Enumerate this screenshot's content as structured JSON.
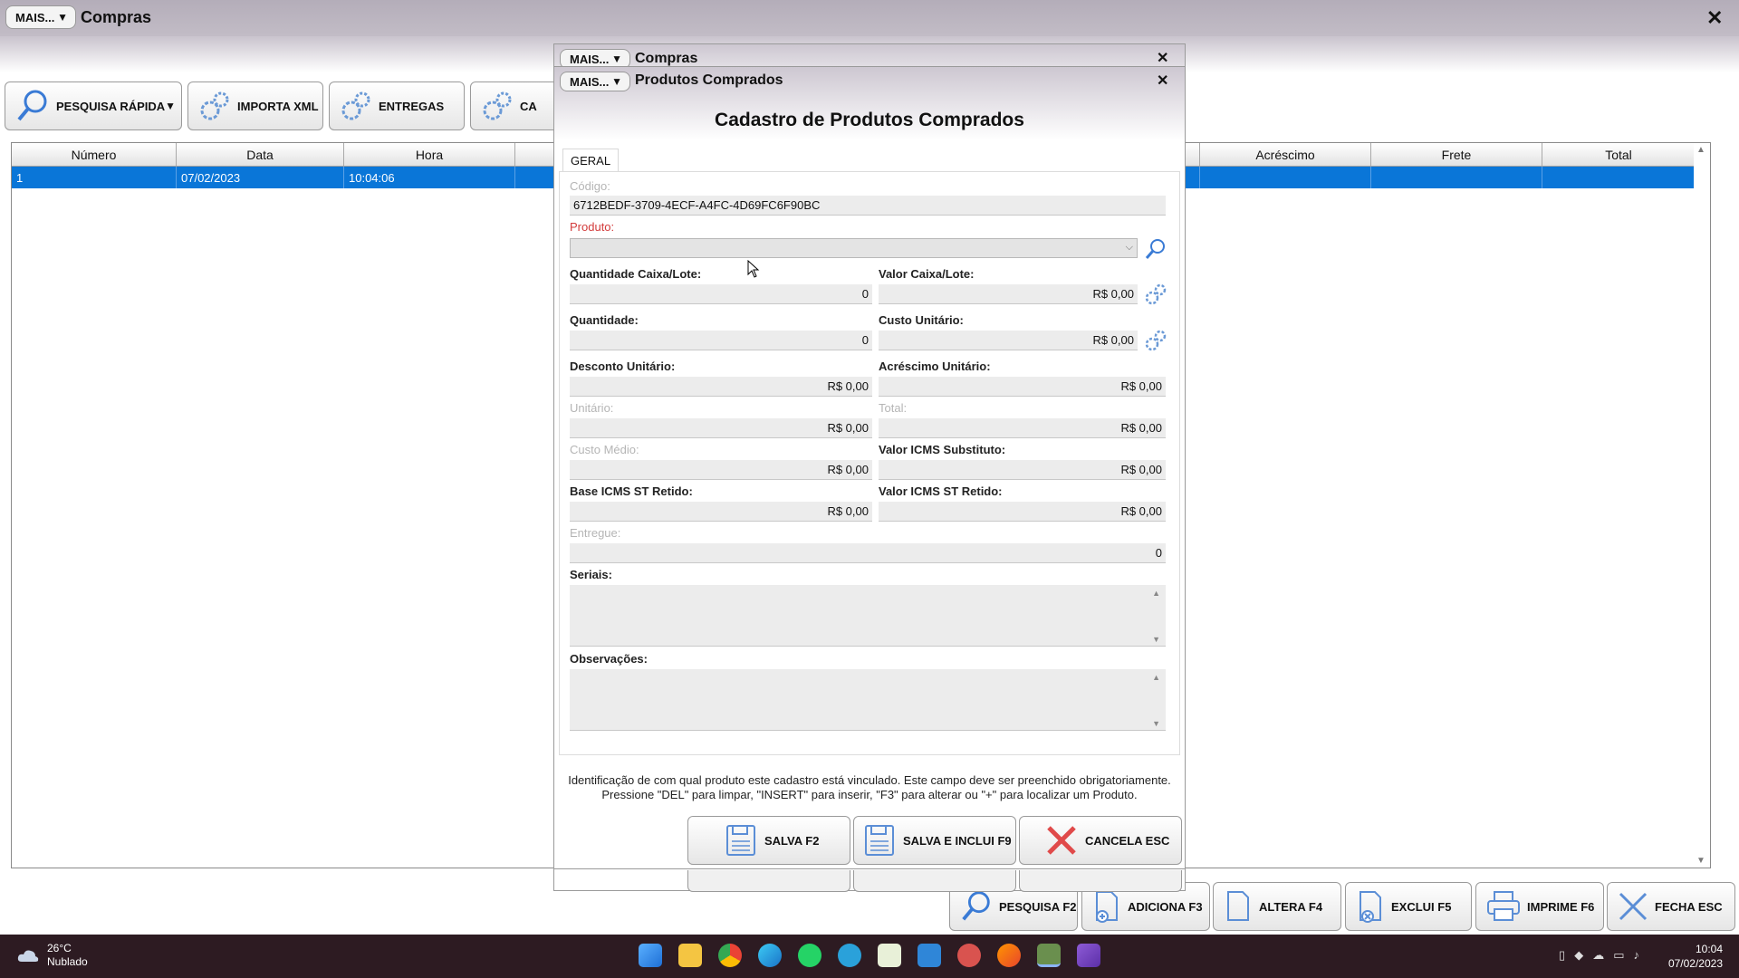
{
  "main": {
    "mais_label": "MAIS...",
    "title": "Compras",
    "toolbar": {
      "pesquisa_rapida": "PESQUISA RÁPIDA",
      "importa_xml": "IMPORTA XML",
      "entregas": "ENTREGAS",
      "partial": "CA"
    },
    "grid": {
      "columns": [
        "Número",
        "Data",
        "Hora",
        "",
        "",
        "",
        "",
        "Acréscimo",
        "Frete",
        "Total"
      ],
      "rows": [
        {
          "numero": "1",
          "data": "07/02/2023",
          "hora": "10:04:06"
        }
      ]
    },
    "bottom": {
      "pesquisa": "PESQUISA F2",
      "adiciona": "ADICIONA F3",
      "altera": "ALTERA F4",
      "exclui": "EXCLUI F5",
      "imprime": "IMPRIME F6",
      "fecha": "FECHA ESC"
    }
  },
  "outer_dialog": {
    "mais_label": "MAIS...",
    "title": "Compras"
  },
  "dialog": {
    "mais_label": "MAIS...",
    "window_title": "Produtos Comprados",
    "heading": "Cadastro de Produtos Comprados",
    "tab": "GERAL",
    "fields": {
      "codigo_label": "Código:",
      "codigo_value": "6712BEDF-3709-4ECF-A4FC-4D69FC6F90BC",
      "produto_label": "Produto:",
      "produto_value": "",
      "qtd_caixa_label": "Quantidade Caixa/Lote:",
      "qtd_caixa_value": "0",
      "valor_caixa_label": "Valor Caixa/Lote:",
      "valor_caixa_value": "R$ 0,00",
      "quantidade_label": "Quantidade:",
      "quantidade_value": "0",
      "custo_unit_label": "Custo Unitário:",
      "custo_unit_value": "R$ 0,00",
      "desconto_label": "Desconto Unitário:",
      "desconto_value": "R$ 0,00",
      "acrescimo_label": "Acréscimo Unitário:",
      "acrescimo_value": "R$ 0,00",
      "unitario_label": "Unitário:",
      "unitario_value": "R$ 0,00",
      "total_label": "Total:",
      "total_value": "R$ 0,00",
      "custo_medio_label": "Custo Médio:",
      "custo_medio_value": "R$ 0,00",
      "icms_sub_label": "Valor ICMS Substituto:",
      "icms_sub_value": "R$ 0,00",
      "base_icms_label": "Base ICMS ST Retido:",
      "base_icms_value": "R$ 0,00",
      "valor_icms_ret_label": "Valor ICMS ST Retido:",
      "valor_icms_ret_value": "R$ 0,00",
      "entregue_label": "Entregue:",
      "entregue_value": "0",
      "seriais_label": "Seriais:",
      "observacoes_label": "Observações:"
    },
    "hint_line1": "Identificação de com qual produto este cadastro está vinculado. Este campo deve ser preenchido obrigatoriamente.",
    "hint_line2": "Pressione \"DEL\" para limpar, \"INSERT\" para inserir, \"F3\" para alterar ou \"+\" para localizar um Produto.",
    "buttons": {
      "salva": "SALVA F2",
      "salva_inclui": "SALVA E INCLUI F9",
      "cancela": "CANCELA ESC"
    }
  },
  "taskbar": {
    "temperature": "26°C",
    "weather": "Nublado",
    "time": "10:04",
    "date": "07/02/2023"
  },
  "colors": {
    "selection": "#0a76d8",
    "title_band": "#b4adb9",
    "taskbar": "#2d1b22",
    "required_label": "#d33b3b"
  }
}
